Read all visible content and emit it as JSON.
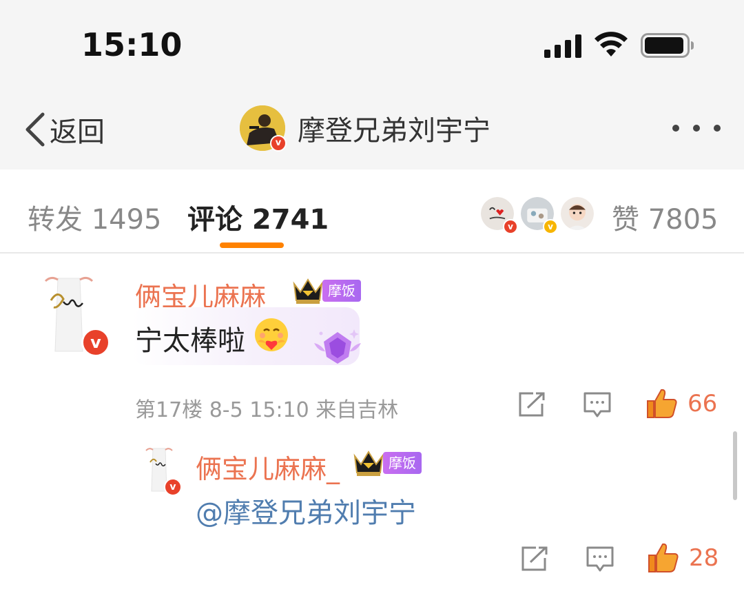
{
  "status_bar": {
    "time": "15:10"
  },
  "nav": {
    "back_label": "返回",
    "title": "摩登兄弟刘宇宁"
  },
  "tabs": {
    "repost": "转发 1495",
    "comment": "评论 2741",
    "like": "赞 7805"
  },
  "comment": {
    "username": "俩宝儿麻麻_",
    "fan_badge": "摩饭",
    "text": "宁太棒啦",
    "meta": "第17楼 8-5 15:10 来自吉林",
    "like_count": "66"
  },
  "reply": {
    "username": "俩宝儿麻麻_",
    "fan_badge": "摩饭",
    "text": "@摩登兄弟刘宇宁",
    "like_count": "28"
  },
  "colors": {
    "accent_orange": "#ff8200",
    "username": "#eb7350",
    "mention": "#507daf",
    "verified_badge": "#e8412a"
  }
}
